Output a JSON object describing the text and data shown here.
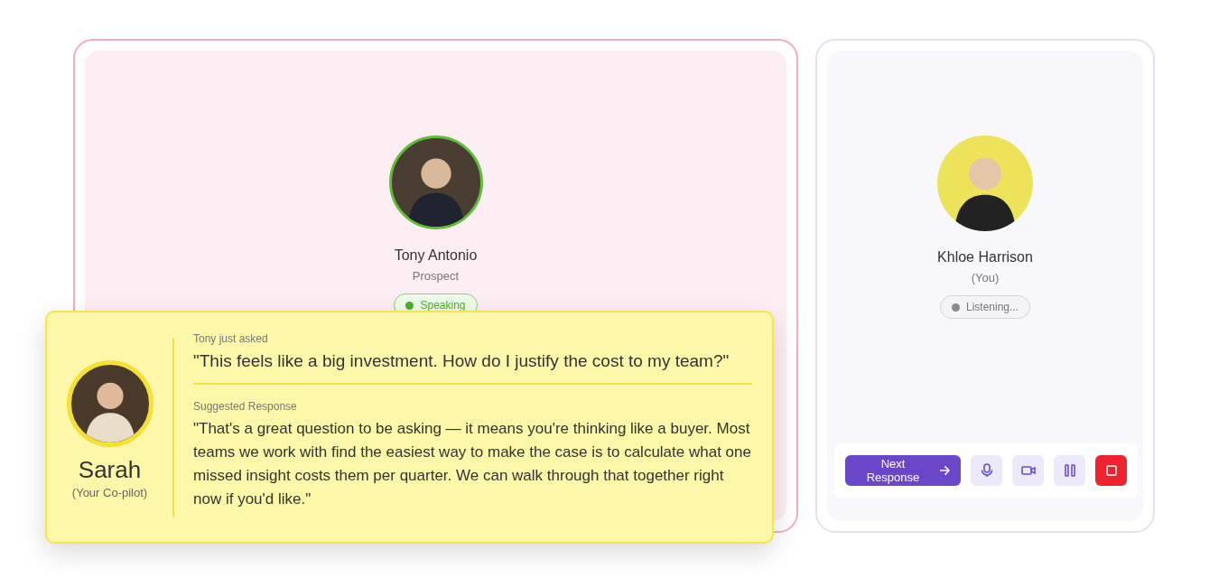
{
  "prospect": {
    "name": "Tony Antonio",
    "role": "Prospect",
    "status": {
      "label": "Speaking",
      "kind": "speaking"
    }
  },
  "you": {
    "name": "Khloe Harrison",
    "role": "(You)",
    "status": {
      "label": "Listening...",
      "kind": "listening"
    }
  },
  "copilot": {
    "name": "Sarah",
    "role": "(Your Co-pilot)",
    "question_label": "Tony just asked",
    "question": "\"This feels like a big investment. How do I justify the cost to my team?\"",
    "response_label": "Suggested Response",
    "response": "\"That's a great question to be asking — it means you're thinking like a buyer. Most teams we work with find the easiest way to make the case is to calculate what one missed insight costs them per quarter. We can walk through that together right now if you'd like.\""
  },
  "controls": [
    {
      "kind": "primary",
      "label": "Next Response"
    },
    {
      "kind": "mic"
    },
    {
      "kind": "camera"
    },
    {
      "kind": "pause"
    },
    {
      "kind": "stop"
    }
  ]
}
